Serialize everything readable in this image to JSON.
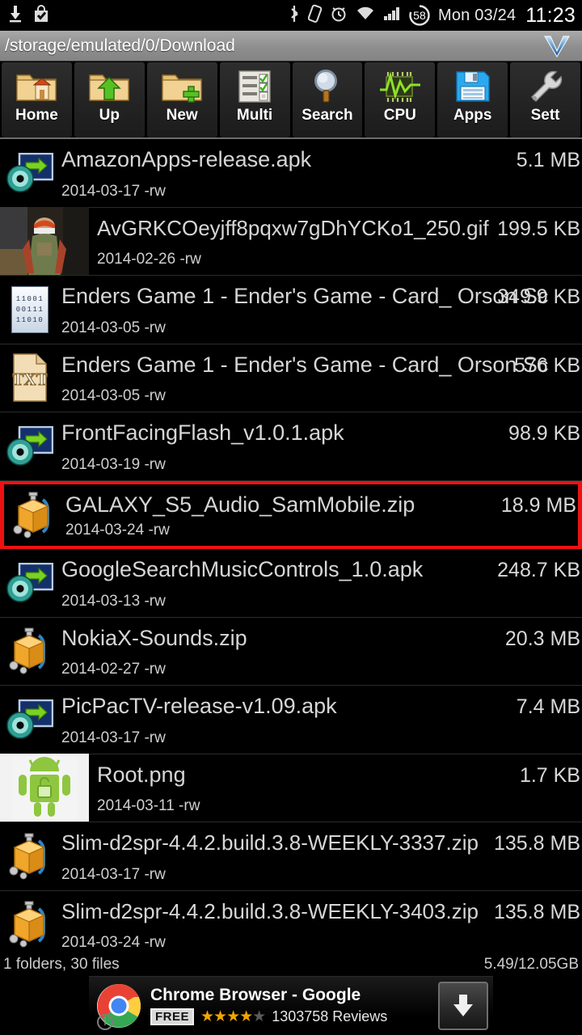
{
  "statusbar": {
    "left_icons": [
      "download-icon",
      "play-store-bag-icon"
    ],
    "right_icons": [
      "bluetooth-icon",
      "nfc-icon",
      "alarm-icon",
      "wifi-icon",
      "signal-icon"
    ],
    "battery_percent": "58",
    "date": "Mon 03/24",
    "time": "11:23"
  },
  "pathbar": {
    "path": "/storage/emulated/0/Download",
    "logo": "v-chevron-logo"
  },
  "toolbar": {
    "buttons": [
      {
        "label": "Home",
        "icon": "folder-home-icon"
      },
      {
        "label": "Up",
        "icon": "folder-up-arrow-icon"
      },
      {
        "label": "New",
        "icon": "folder-plus-icon"
      },
      {
        "label": "Multi",
        "icon": "checklist-icon"
      },
      {
        "label": "Search",
        "icon": "magnifier-icon"
      },
      {
        "label": "CPU",
        "icon": "cpu-graph-icon"
      },
      {
        "label": "Apps",
        "icon": "floppy-disk-icon"
      },
      {
        "label": "Sett",
        "icon": "wrench-icon"
      }
    ]
  },
  "file_list": {
    "rows": [
      {
        "name": "AmazonApps-release.apk",
        "date": "2014-03-17 -rw",
        "size": "5.1 MB",
        "icon": "apk-icon",
        "selected": false
      },
      {
        "name": "AvGRKCOeyjff8pqxw7gDhYCKo1_250.gif",
        "date": "2014-02-26 -rw",
        "size": "199.5 KB",
        "icon": "gif-thumbnail",
        "selected": false
      },
      {
        "name": "Enders Game 1 - Ender's Game - Card_ Orson Sc",
        "date": "2014-03-05 -rw",
        "size": "349.9 KB",
        "icon": "binary-file-icon",
        "selected": false
      },
      {
        "name": "Enders Game 1 - Ender's Game - Card_ Orson Sc",
        "date": "2014-03-05 -rw",
        "size": "576 KB",
        "icon": "txt-file-icon",
        "selected": false
      },
      {
        "name": "FrontFacingFlash_v1.0.1.apk",
        "date": "2014-03-19 -rw",
        "size": "98.9 KB",
        "icon": "apk-icon",
        "selected": false
      },
      {
        "name": "GALAXY_S5_Audio_SamMobile.zip",
        "date": "2014-03-24 -rw",
        "size": "18.9 MB",
        "icon": "zip-icon",
        "selected": true
      },
      {
        "name": "GoogleSearchMusicControls_1.0.apk",
        "date": "2014-03-13 -rw",
        "size": "248.7 KB",
        "icon": "apk-icon",
        "selected": false
      },
      {
        "name": "NokiaX-Sounds.zip",
        "date": "2014-02-27 -rw",
        "size": "20.3 MB",
        "icon": "zip-icon",
        "selected": false
      },
      {
        "name": "PicPacTV-release-v1.09.apk",
        "date": "2014-03-17 -rw",
        "size": "7.4 MB",
        "icon": "apk-icon",
        "selected": false
      },
      {
        "name": "Root.png",
        "date": "2014-03-11 -rw",
        "size": "1.7 KB",
        "icon": "png-thumbnail",
        "selected": false
      },
      {
        "name": "Slim-d2spr-4.4.2.build.3.8-WEEKLY-3337.zip",
        "date": "2014-03-17 -rw",
        "size": "135.8 MB",
        "icon": "zip-icon",
        "selected": false
      },
      {
        "name": "Slim-d2spr-4.4.2.build.3.8-WEEKLY-3403.zip",
        "date": "2014-03-24 -rw",
        "size": "135.8 MB",
        "icon": "zip-icon",
        "selected": false
      }
    ],
    "selection_color": "#ee1111"
  },
  "bottombar": {
    "counts": "1 folders, 30 files",
    "storage": "5.49/12.05GB"
  },
  "ad": {
    "title": "Chrome Browser - Google",
    "price": "FREE",
    "rating": 4,
    "rating_max": 5,
    "reviews": "1303758 Reviews",
    "download_icon": "download-arrow-icon",
    "info_icon": "info-icon"
  }
}
